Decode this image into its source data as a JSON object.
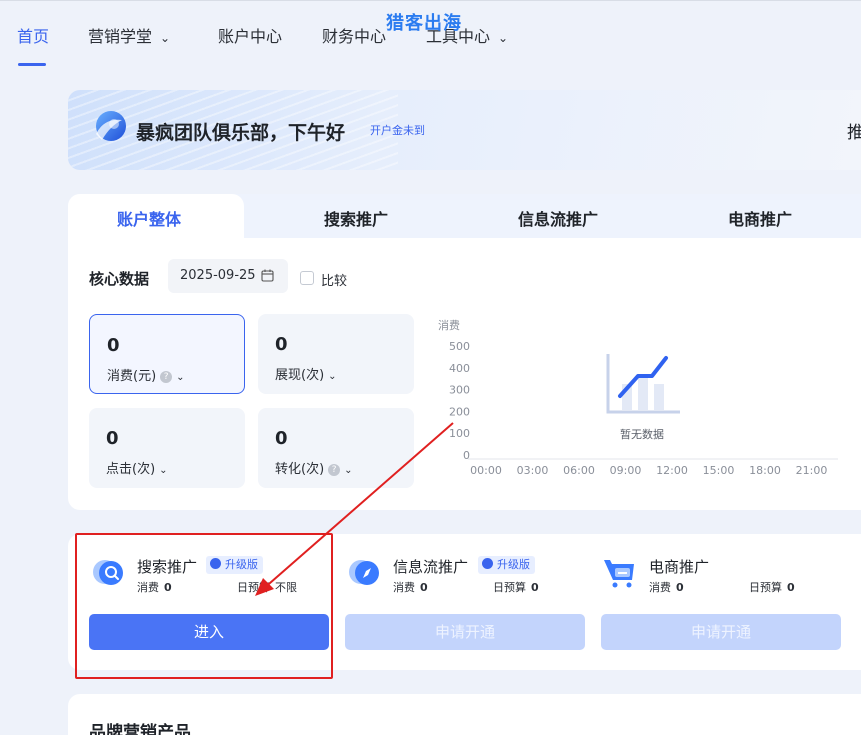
{
  "watermark": "猎客出海",
  "nav": {
    "items": [
      {
        "label": "首页",
        "dropdown": false,
        "active": true
      },
      {
        "label": "营销学堂",
        "dropdown": true
      },
      {
        "label": "账户中心",
        "dropdown": false
      },
      {
        "label": "财务中心",
        "dropdown": false
      },
      {
        "label": "工具中心",
        "dropdown": true
      }
    ]
  },
  "banner": {
    "greeting": "暴疯团队俱乐部，下午好",
    "notice_link": "开户金未到",
    "edge_text": "推"
  },
  "tabs": [
    "账户整体",
    "搜索推广",
    "信息流推广",
    "电商推广"
  ],
  "core": {
    "title": "核心数据",
    "date": "2025-09-25",
    "compare_label": "比较",
    "metrics": [
      {
        "value": "0",
        "label": "消费(元)",
        "help": true,
        "selected": true
      },
      {
        "value": "0",
        "label": "展现(次)",
        "help": false,
        "selected": false
      },
      {
        "value": "0",
        "label": "点击(次)",
        "help": false,
        "selected": false
      },
      {
        "value": "0",
        "label": "转化(次)",
        "help": true,
        "selected": false
      }
    ]
  },
  "chart_data": {
    "type": "line",
    "ylabel": "消费",
    "yticks": [
      "500",
      "400",
      "300",
      "200",
      "100",
      "0"
    ],
    "xticks": [
      "00:00",
      "03:00",
      "06:00",
      "09:00",
      "12:00",
      "15:00",
      "18:00",
      "21:00"
    ],
    "ylim": [
      0,
      500
    ],
    "series": [],
    "empty_text": "暂无数据",
    "grid": false
  },
  "products": [
    {
      "name": "搜索推广",
      "badge": "升级版",
      "spend_label": "消费",
      "spend": "0",
      "budget_label": "日预算",
      "budget": "不限",
      "button": "进入",
      "enabled": true
    },
    {
      "name": "信息流推广",
      "badge": "升级版",
      "spend_label": "消费",
      "spend": "0",
      "budget_label": "日预算",
      "budget": "0",
      "button": "申请开通",
      "enabled": false
    },
    {
      "name": "电商推广",
      "badge": "",
      "spend_label": "消费",
      "spend": "0",
      "budget_label": "日预算",
      "budget": "0",
      "button": "申请开通",
      "enabled": false
    }
  ],
  "brand": {
    "title": "品牌营销产品"
  },
  "colors": {
    "accent": "#3a64ee",
    "annotation": "#e02020"
  }
}
